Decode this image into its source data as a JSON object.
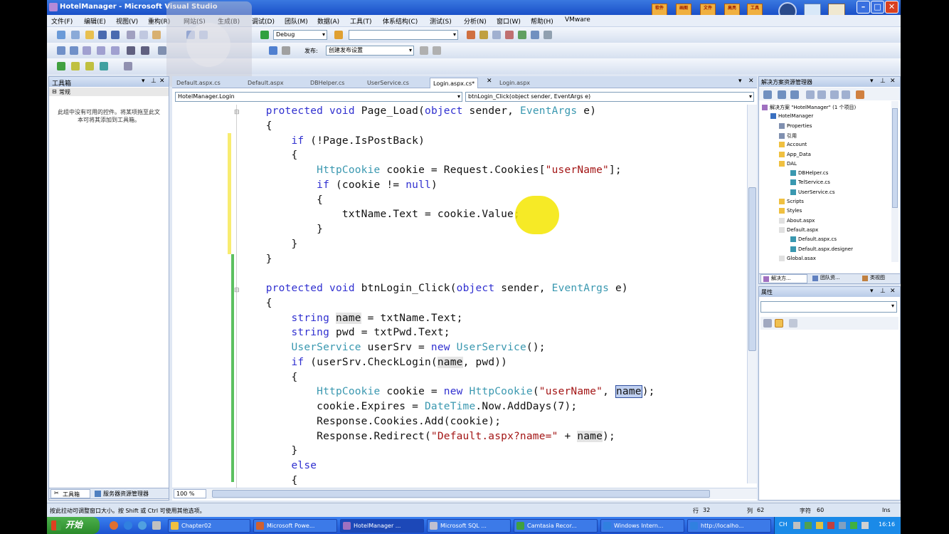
{
  "window": {
    "title": "HotelManager - Microsoft Visual Studio"
  },
  "title_tools": [
    "软件",
    "画图",
    "文件",
    "高亮",
    "工具"
  ],
  "menu": [
    "文件(F)",
    "编辑(E)",
    "视图(V)",
    "重构(R)",
    "网站(S)",
    "生成(B)",
    "调试(D)",
    "团队(M)",
    "数据(A)",
    "工具(T)",
    "体系结构(C)",
    "测试(S)",
    "分析(N)",
    "窗口(W)",
    "帮助(H)",
    "VMware"
  ],
  "toolbar": {
    "config": "Debug",
    "platform": "",
    "deploy_label": "发布:",
    "deploy_value": "创建发布设置"
  },
  "toolbox": {
    "title": "工具箱",
    "section": "常规",
    "empty_text": "此组中没有可用的控件。将某项拖至此文本可将其添加到工具箱。"
  },
  "bottom_tabs": {
    "toolbox": "工具箱",
    "server_explorer": "服务器资源管理器"
  },
  "doc_tabs": [
    "Default.aspx.cs",
    "Default.aspx",
    "DBHelper.cs",
    "UserService.cs",
    "Login.aspx.cs*",
    "Login.aspx"
  ],
  "nav": {
    "class_combo": "HotelManager.Login",
    "member_combo": "btnLogin_Click(object sender, EventArgs e)"
  },
  "code": [
    [
      [
        "    ",
        ""
      ],
      [
        "protected",
        "kw"
      ],
      [
        " ",
        ""
      ],
      [
        "void",
        "kw"
      ],
      [
        " Page_Load(",
        ""
      ],
      [
        "object",
        "kw"
      ],
      [
        " sender, ",
        ""
      ],
      [
        "EventArgs",
        "ty"
      ],
      [
        " e)",
        ""
      ]
    ],
    [
      [
        "    {",
        ""
      ]
    ],
    [
      [
        "        ",
        ""
      ],
      [
        "if",
        "kw"
      ],
      [
        " (!Page.IsPostBack)",
        ""
      ]
    ],
    [
      [
        "        {",
        ""
      ]
    ],
    [
      [
        "            ",
        ""
      ],
      [
        "HttpCookie",
        "ty"
      ],
      [
        " cookie = Request.Cookies[",
        ""
      ],
      [
        "\"userName\"",
        "st"
      ],
      [
        "];",
        ""
      ]
    ],
    [
      [
        "            ",
        ""
      ],
      [
        "if",
        "kw"
      ],
      [
        " (cookie != ",
        ""
      ],
      [
        "null",
        "kw"
      ],
      [
        ")",
        ""
      ]
    ],
    [
      [
        "            {",
        ""
      ]
    ],
    [
      [
        "                txtName.Text = cookie.Value;",
        ""
      ]
    ],
    [
      [
        "            }",
        ""
      ]
    ],
    [
      [
        "        }",
        ""
      ]
    ],
    [
      [
        "    }",
        ""
      ]
    ],
    [
      [
        "",
        ""
      ]
    ],
    [
      [
        "    ",
        ""
      ],
      [
        "protected",
        "kw"
      ],
      [
        " ",
        ""
      ],
      [
        "void",
        "kw"
      ],
      [
        " btnLogin_Click(",
        ""
      ],
      [
        "object",
        "kw"
      ],
      [
        " sender, ",
        ""
      ],
      [
        "EventArgs",
        "ty"
      ],
      [
        " e)",
        ""
      ]
    ],
    [
      [
        "    {",
        ""
      ]
    ],
    [
      [
        "        ",
        ""
      ],
      [
        "string",
        "kw"
      ],
      [
        " ",
        ""
      ],
      [
        "name",
        "hl"
      ],
      [
        " = txtName.Text;",
        ""
      ]
    ],
    [
      [
        "        ",
        ""
      ],
      [
        "string",
        "kw"
      ],
      [
        " pwd = txtPwd.Text;",
        ""
      ]
    ],
    [
      [
        "        ",
        ""
      ],
      [
        "UserService",
        "ty"
      ],
      [
        " userSrv = ",
        ""
      ],
      [
        "new",
        "kw"
      ],
      [
        " ",
        ""
      ],
      [
        "UserService",
        "ty"
      ],
      [
        "();",
        ""
      ]
    ],
    [
      [
        "        ",
        ""
      ],
      [
        "if",
        "kw"
      ],
      [
        " (userSrv.CheckLogin(",
        ""
      ],
      [
        "name",
        "hl"
      ],
      [
        ", pwd))",
        ""
      ]
    ],
    [
      [
        "        {",
        ""
      ]
    ],
    [
      [
        "            ",
        ""
      ],
      [
        "HttpCookie",
        "ty"
      ],
      [
        " cookie = ",
        ""
      ],
      [
        "new",
        "kw"
      ],
      [
        " ",
        ""
      ],
      [
        "HttpCookie",
        "ty"
      ],
      [
        "(",
        ""
      ],
      [
        "\"userName\"",
        "st"
      ],
      [
        ", ",
        ""
      ],
      [
        "name",
        "sel"
      ],
      [
        ");",
        ""
      ]
    ],
    [
      [
        "            cookie.Expires = ",
        ""
      ],
      [
        "DateTime",
        "ty"
      ],
      [
        ".Now.AddDays(7);",
        ""
      ]
    ],
    [
      [
        "            Response.Cookies.Add(cookie);",
        ""
      ]
    ],
    [
      [
        "            Response.Redirect(",
        ""
      ],
      [
        "\"Default.aspx?name=\"",
        "st"
      ],
      [
        " + ",
        ""
      ],
      [
        "name",
        "hl"
      ],
      [
        ");",
        ""
      ]
    ],
    [
      [
        "        }",
        ""
      ]
    ],
    [
      [
        "        ",
        ""
      ],
      [
        "else",
        "kw"
      ]
    ],
    [
      [
        "        {",
        ""
      ]
    ]
  ],
  "editor": {
    "zoom": "100 %"
  },
  "solution_explorer": {
    "title": "解决方案资源管理器",
    "items": [
      "解决方案 \"HotelManager\" (1 个项目)",
      "HotelManager",
      "Properties",
      "引用",
      "Account",
      "App_Data",
      "DAL",
      "DBHelper.cs",
      "TelService.cs",
      "UserService.cs",
      "Scripts",
      "Styles",
      "About.aspx",
      "Default.aspx",
      "Default.aspx.cs",
      "Default.aspx.designer",
      "Global.asax"
    ],
    "tabs": [
      "解决方...",
      "团队资...",
      "类视图"
    ]
  },
  "properties": {
    "title": "属性"
  },
  "status": {
    "message": "按此拉动可调整窗口大小。按 Shift 或 Ctrl 可使用其他选项。",
    "row_label": "行",
    "row": "32",
    "col_label": "列",
    "col": "62",
    "char_label": "字符",
    "char": "60",
    "mode": "Ins"
  },
  "taskbar": {
    "start": "开始",
    "tasks": [
      "Chapter02",
      "Microsoft Powe...",
      "HotelManager ...",
      "Microsoft SQL ...",
      "Camtasia Recor...",
      "Windows Intern...",
      "http://localho..."
    ],
    "lang": "CH",
    "clock": "16:16"
  },
  "colors": {
    "keyword": "#3030d0",
    "type": "#3a98b0",
    "string": "#a31515",
    "cursor_highlight": "#f5e600",
    "change_bar": "#f8ec70",
    "saved_bar": "#5cc060"
  }
}
